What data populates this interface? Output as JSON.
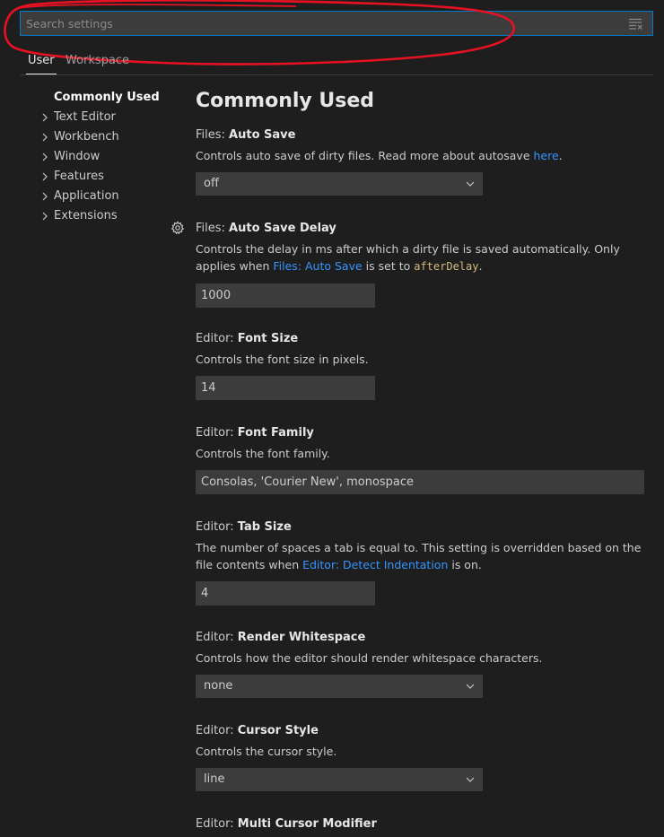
{
  "search": {
    "placeholder": "Search settings",
    "value": "",
    "clear_filter_icon": "clear-filter-icon",
    "border_color": "#007acc"
  },
  "annotation": {
    "shape": "hand-drawn red ellipse around search box",
    "color": "#e81123"
  },
  "tabs": [
    {
      "label": "User",
      "active": true
    },
    {
      "label": "Workspace",
      "active": false
    }
  ],
  "toc": {
    "active": "Commonly Used",
    "items": [
      "Text Editor",
      "Workbench",
      "Window",
      "Features",
      "Application",
      "Extensions"
    ],
    "chevron_icon": "chevron-right-icon"
  },
  "section_title": "Commonly Used",
  "settings": {
    "auto_save": {
      "category": "Files: ",
      "key": "Auto Save",
      "desc_text": "Controls auto save of dirty files. Read more about autosave ",
      "desc_link": "here",
      "desc_end": ".",
      "value": "off"
    },
    "auto_save_delay": {
      "category": "Files: ",
      "key": "Auto Save Delay",
      "desc_text": "Controls the delay in ms after which a dirty file is saved automatically. Only applies when ",
      "desc_link": "Files: Auto Save",
      "desc_mid": " is set to ",
      "desc_code": "afterDelay",
      "desc_end": ".",
      "value": "1000",
      "gear_icon": "gear-icon"
    },
    "font_size": {
      "category": "Editor: ",
      "key": "Font Size",
      "desc_text": "Controls the font size in pixels.",
      "value": "14"
    },
    "font_family": {
      "category": "Editor: ",
      "key": "Font Family",
      "desc_text": "Controls the font family.",
      "value": "Consolas, 'Courier New', monospace"
    },
    "tab_size": {
      "category": "Editor: ",
      "key": "Tab Size",
      "desc_text": "The number of spaces a tab is equal to. This setting is overridden based on the file contents when ",
      "desc_link": "Editor: Detect Indentation",
      "desc_end": " is on.",
      "value": "4"
    },
    "render_whitespace": {
      "category": "Editor: ",
      "key": "Render Whitespace",
      "desc_text": "Controls how the editor should render whitespace characters.",
      "value": "none"
    },
    "cursor_style": {
      "category": "Editor: ",
      "key": "Cursor Style",
      "desc_text": "Controls the cursor style.",
      "value": "line"
    },
    "multi_cursor_modifier": {
      "category": "Editor: ",
      "key": "Multi Cursor Modifier"
    }
  },
  "colors": {
    "background": "#1e1e1e",
    "input_background": "#3c3c3c",
    "link": "#3794ff",
    "code": "#d7ba7d"
  }
}
